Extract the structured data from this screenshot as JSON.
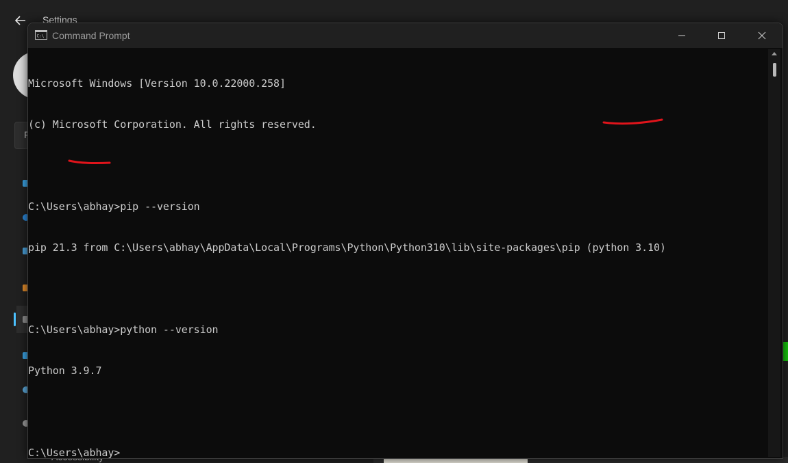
{
  "settings": {
    "title": "Settings",
    "search_peek": "F",
    "accessibility_label": "Accessibility"
  },
  "window": {
    "title": "Command Prompt",
    "icon": "cmd-icon"
  },
  "console": {
    "lines": [
      "Microsoft Windows [Version 10.0.22000.258]",
      "(c) Microsoft Corporation. All rights reserved.",
      "",
      "C:\\Users\\abhay>pip --version",
      "pip 21.3 from C:\\Users\\abhay\\AppData\\Local\\Programs\\Python\\Python310\\lib\\site-packages\\pip (python 3.10)",
      "",
      "C:\\Users\\abhay>python --version",
      "Python 3.9.7",
      "",
      "C:\\Users\\abhay>"
    ]
  },
  "colors": {
    "console_bg": "#0c0c0c",
    "console_text": "#cccccc",
    "annotation": "#e0141b",
    "accent": "#4cc2ff"
  }
}
